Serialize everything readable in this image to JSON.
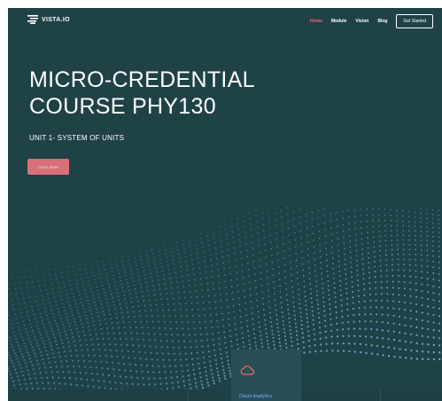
{
  "brand": {
    "name": "VISTA.IO",
    "icon": "bars-logo-icon"
  },
  "nav": {
    "items": [
      {
        "label": "Home",
        "active": true
      },
      {
        "label": "Module",
        "active": false
      },
      {
        "label": "Vision",
        "active": false
      },
      {
        "label": "Blog",
        "active": false
      }
    ],
    "cta_label": "Get Started"
  },
  "hero": {
    "title_line1": "MICRO-CREDENTIAL",
    "title_line2": "COURSE PHY130",
    "subtitle": "UNIT 1- SYSTEM OF UNITS",
    "button_label": "Learn More",
    "background": "particle-wave"
  },
  "feature_card": {
    "icon": "cloud-icon",
    "label": "Cloud Analytics"
  },
  "colors": {
    "background": "#1f4246",
    "accent": "#e86a6a",
    "button": "#d8707a",
    "card": "#294e53",
    "card_label": "#5d9be8",
    "particles": "#8fb8e8"
  }
}
